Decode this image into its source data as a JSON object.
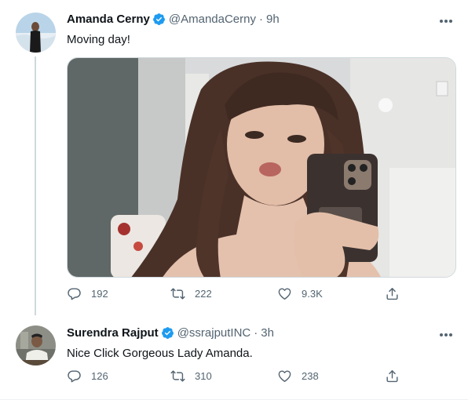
{
  "tweets": [
    {
      "name": "Amanda Cerny",
      "handle": "@AmandaCerny",
      "time": "9h",
      "text": "Moving day!",
      "replies": "192",
      "retweets": "222",
      "likes": "9.3K"
    },
    {
      "name": "Surendra Rajput",
      "handle": "@ssrajputINC",
      "time": "3h",
      "text": "Nice Click Gorgeous Lady Amanda.",
      "replies": "126",
      "retweets": "310",
      "likes": "238"
    }
  ],
  "separator": "·",
  "icons": {
    "verified": "verified-badge-icon",
    "more": "more-dots-icon",
    "reply": "reply-icon",
    "retweet": "retweet-icon",
    "like": "heart-icon",
    "share": "share-icon"
  },
  "colors": {
    "verified": "#1d9bf0",
    "text_primary": "#0f1419",
    "text_secondary": "#536471",
    "thread_line": "#cfd9de"
  }
}
